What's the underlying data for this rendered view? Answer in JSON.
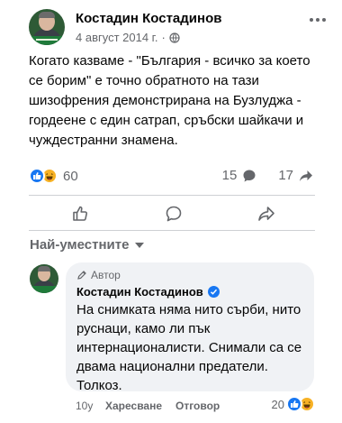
{
  "post": {
    "author": "Костадин Костадинов",
    "date": "4 август 2014 г.",
    "separator": "·",
    "text": "Когато казваме - \"България - всичко за което се борим\" е точно обратното на тази шизофрения демонстрирана на Бузлуджа - гордеене с един сатрап, сръбски шайкачи и чуждестранни знамена.",
    "reaction_count": "60",
    "comment_count": "15",
    "share_count": "17",
    "icons": [
      "globe-icon",
      "more-options-icon",
      "like-reaction-icon",
      "haha-reaction-icon",
      "comment-icon",
      "share-icon"
    ]
  },
  "actions": {
    "icons": [
      "like-icon",
      "comment-icon",
      "share-icon"
    ]
  },
  "comments_sort": {
    "label": "Най-уместните"
  },
  "comment": {
    "badge": "Автор",
    "author": "Костадин Костадинов",
    "text": "На снимката няма нито сърби, нито руснаци, камо ли пък интернационалисти. Снимали са се двама национални предатели. Толкоз.",
    "time": "10у",
    "like_label": "Харесване",
    "reply_label": "Отговор",
    "reaction_count": "20"
  },
  "colors": {
    "accent": "#1877f2",
    "muted": "#65676b",
    "bubble": "#f0f2f5",
    "haha": "#f7b125"
  }
}
